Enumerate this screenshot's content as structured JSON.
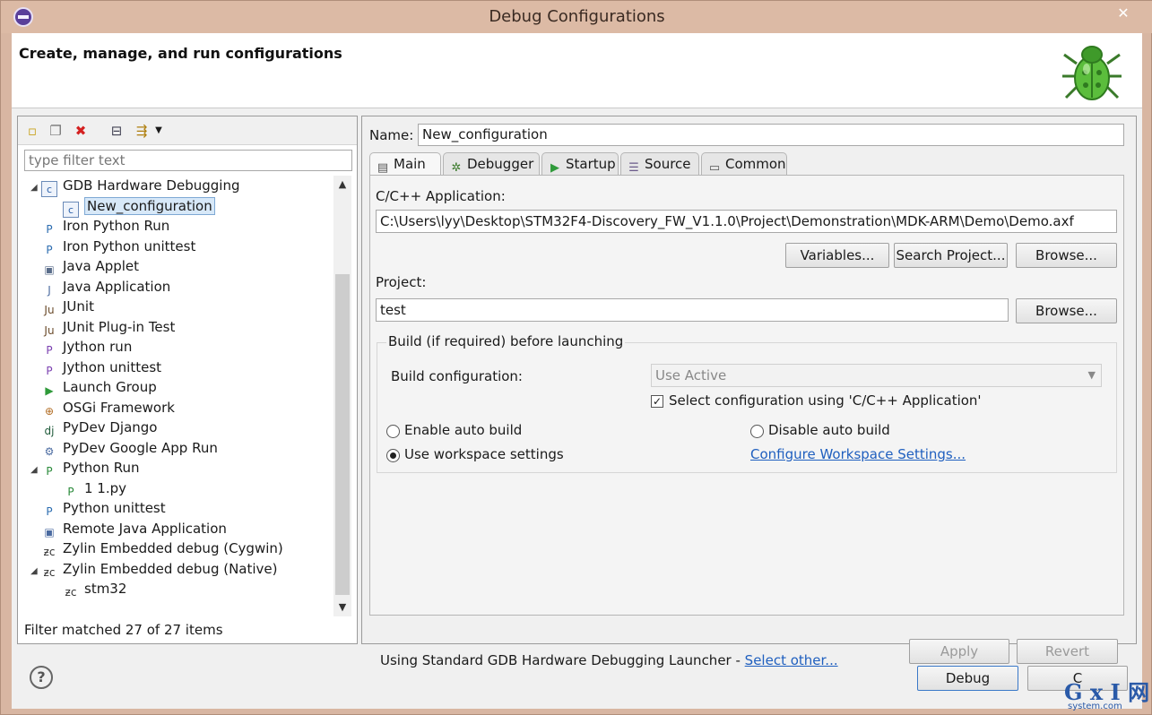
{
  "window": {
    "title": "Debug Configurations",
    "close_glyph": "✕"
  },
  "banner": {
    "title": "Create, manage, and run configurations",
    "icon": "bug-icon"
  },
  "left": {
    "toolbar_icons": [
      "new-config-icon",
      "duplicate-icon",
      "delete-icon",
      "collapse-all-icon",
      "filter-icon",
      "dropdown-icon"
    ],
    "filter_placeholder": "type filter text",
    "tree": [
      {
        "label": "GDB Hardware Debugging",
        "level": 0,
        "expanded": true,
        "icon": "c-config-icon",
        "icon_glyph": "c"
      },
      {
        "label": "New_configuration",
        "level": 1,
        "selected": true,
        "icon": "c-config-icon",
        "icon_glyph": "c"
      },
      {
        "label": "Iron Python Run",
        "level": 0,
        "icon": "python-icon",
        "icon_glyph": "P"
      },
      {
        "label": "Iron Python unittest",
        "level": 0,
        "icon": "python-unittest-icon",
        "icon_glyph": "P"
      },
      {
        "label": "Java Applet",
        "level": 0,
        "icon": "java-applet-icon",
        "icon_glyph": "▣"
      },
      {
        "label": "Java Application",
        "level": 0,
        "icon": "java-app-icon",
        "icon_glyph": "J"
      },
      {
        "label": "JUnit",
        "level": 0,
        "icon": "junit-icon",
        "icon_glyph": "Ju"
      },
      {
        "label": "JUnit Plug-in Test",
        "level": 0,
        "icon": "junit-plugin-icon",
        "icon_glyph": "Ju"
      },
      {
        "label": "Jython run",
        "level": 0,
        "icon": "jython-icon",
        "icon_glyph": "P"
      },
      {
        "label": "Jython unittest",
        "level": 0,
        "icon": "jython-unittest-icon",
        "icon_glyph": "P"
      },
      {
        "label": "Launch Group",
        "level": 0,
        "icon": "launch-group-icon",
        "icon_glyph": "▶"
      },
      {
        "label": "OSGi Framework",
        "level": 0,
        "icon": "osgi-icon",
        "icon_glyph": "⊕"
      },
      {
        "label": "PyDev Django",
        "level": 0,
        "icon": "django-icon",
        "icon_glyph": "dj"
      },
      {
        "label": "PyDev Google App Run",
        "level": 0,
        "icon": "google-app-icon",
        "icon_glyph": "⚙"
      },
      {
        "label": "Python Run",
        "level": 0,
        "expanded": true,
        "icon": "python-run-icon",
        "icon_glyph": "P"
      },
      {
        "label": "1 1.py",
        "level": 1,
        "icon": "python-file-icon",
        "icon_glyph": "P"
      },
      {
        "label": "Python unittest",
        "level": 0,
        "icon": "python-unittest-icon",
        "icon_glyph": "P"
      },
      {
        "label": "Remote Java Application",
        "level": 0,
        "icon": "remote-java-icon",
        "icon_glyph": "▣"
      },
      {
        "label": "Zylin Embedded debug (Cygwin)",
        "level": 0,
        "icon": "zylin-icon",
        "icon_glyph": "ƶc"
      },
      {
        "label": "Zylin Embedded debug (Native)",
        "level": 0,
        "expanded": true,
        "icon": "zylin-icon",
        "icon_glyph": "ƶc"
      },
      {
        "label": "stm32",
        "level": 1,
        "icon": "zylin-icon",
        "icon_glyph": "ƶc"
      }
    ],
    "status": "Filter matched 27 of 27 items"
  },
  "right": {
    "name_label": "Name:",
    "name_value": "New_configuration",
    "tabs": [
      {
        "label": "Main",
        "icon": "main-tab-icon",
        "glyph": "▤",
        "active": true
      },
      {
        "label": "Debugger",
        "icon": "debugger-tab-icon",
        "glyph": "✲"
      },
      {
        "label": "Startup",
        "icon": "startup-tab-icon",
        "glyph": "▶"
      },
      {
        "label": "Source",
        "icon": "source-tab-icon",
        "glyph": "☰"
      },
      {
        "label": "Common",
        "icon": "common-tab-icon",
        "glyph": "▭"
      }
    ],
    "app_label": "C/C++ Application:",
    "app_value": "C:\\Users\\lyy\\Desktop\\STM32F4-Discovery_FW_V1.1.0\\Project\\Demonstration\\MDK-ARM\\Demo\\Demo.axf",
    "variables_btn": "Variables...",
    "search_project_btn": "Search Project...",
    "browse_btn": "Browse...",
    "project_label": "Project:",
    "project_value": "test",
    "project_browse_btn": "Browse...",
    "build_group_title": "Build (if required) before launching",
    "build_config_label": "Build configuration:",
    "build_config_value": "Use Active",
    "select_config_label": "Select configuration using 'C/C++ Application'",
    "select_config_checked": true,
    "enable_auto_build": "Enable auto build",
    "disable_auto_build": "Disable auto build",
    "use_workspace": "Use workspace settings",
    "configure_workspace": "Configure Workspace Settings...",
    "launcher_text": "Using Standard GDB Hardware Debugging Launcher - ",
    "select_other": "Select other...",
    "apply_btn": "Apply",
    "revert_btn": "Revert"
  },
  "bottom": {
    "help_glyph": "?",
    "debug_btn": "Debug",
    "close_btn": "C"
  },
  "watermark": {
    "main": "G x I 网",
    "sub": "system.com"
  }
}
